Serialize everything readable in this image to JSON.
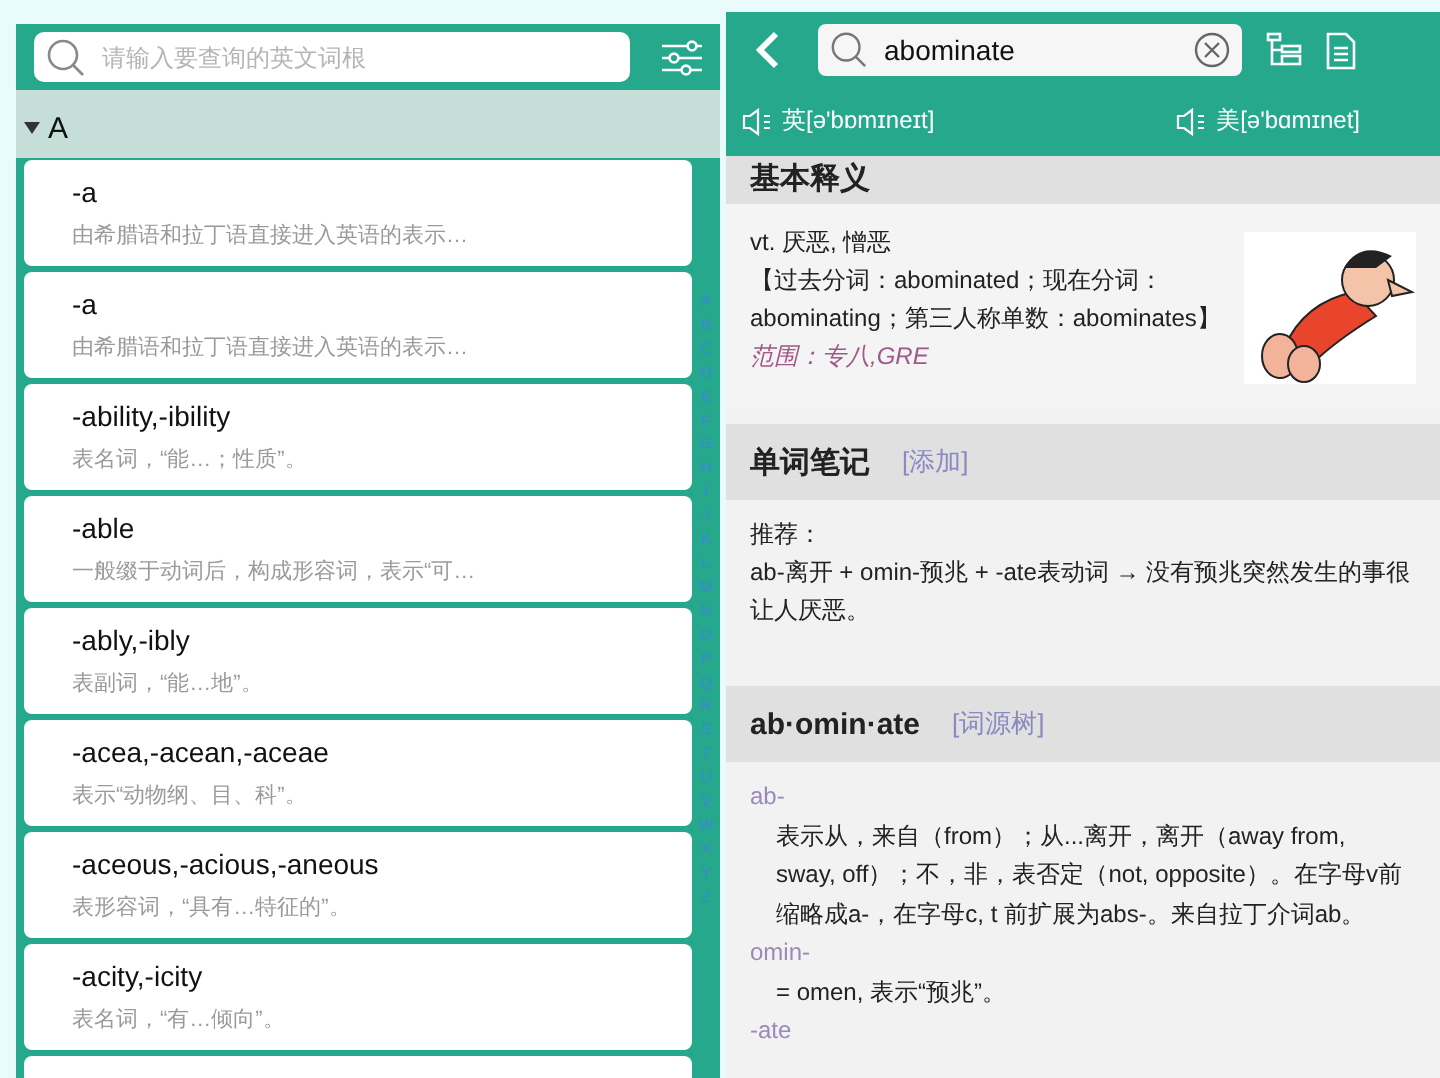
{
  "left": {
    "search": {
      "placeholder": "请输入要查询的英文词根"
    },
    "section": {
      "letter": "A",
      "expanded": true
    },
    "entries": [
      {
        "term": "-a",
        "gloss": "由希腊语和拉丁语直接进入英语的表示…"
      },
      {
        "term": "-a",
        "gloss": "由希腊语和拉丁语直接进入英语的表示…"
      },
      {
        "term": "-ability,-ibility",
        "gloss": "表名词，“能…；性质”。"
      },
      {
        "term": "-able",
        "gloss": "一般缀于动词后，构成形容词，表示“可…"
      },
      {
        "term": "-ably,-ibly",
        "gloss": "表副词，“能…地”。"
      },
      {
        "term": "-acea,-acean,-aceae",
        "gloss": "表示“动物纲、目、科”。"
      },
      {
        "term": "-aceous,-acious,-aneous",
        "gloss": "表形容词，“具有…特征的”。"
      },
      {
        "term": "-acity,-icity",
        "gloss": "表名词，“有…倾向”。"
      }
    ],
    "index_letters": [
      "A",
      "B",
      "C",
      "D",
      "E",
      "F",
      "G",
      "H",
      "I",
      "J",
      "K",
      "L",
      "M",
      "N",
      "O",
      "P",
      "Q",
      "R",
      "S",
      "T",
      "U",
      "V",
      "W",
      "X",
      "Y",
      "Z"
    ]
  },
  "right": {
    "search": {
      "value": "abominate"
    },
    "pronunciations": [
      {
        "label": "英[ə'bɒmɪneɪt]"
      },
      {
        "label": "美[ə'bɑmɪnet]"
      }
    ],
    "basic": {
      "heading": "基本释义",
      "definition": "vt. 厌恶, 憎恶",
      "forms": "【过去分词：abominated；现在分词：abominating；第三人称单数：abominates】",
      "scope": "范围：专八,GRE"
    },
    "notes": {
      "heading": "单词笔记",
      "action": "[添加]",
      "label": "推荐：",
      "text": "ab-离开 + omin-预兆 + -ate表动词 → 没有预兆突然发生的事很让人厌恶。"
    },
    "etymology": {
      "heading": "ab·omin·ate",
      "action": "[词源树]",
      "roots": [
        {
          "root": "ab-",
          "meaning": "表示从，来自（from）；从...离开，离开（away from, sway, off）；不，非，表否定（not, opposite）。在字母v前缩略成a-，在字母c, t 前扩展为abs-。来自拉丁介词ab。"
        },
        {
          "root": "omin-",
          "meaning": "= omen, 表示“预兆”。"
        },
        {
          "root": "-ate"
        }
      ]
    }
  }
}
